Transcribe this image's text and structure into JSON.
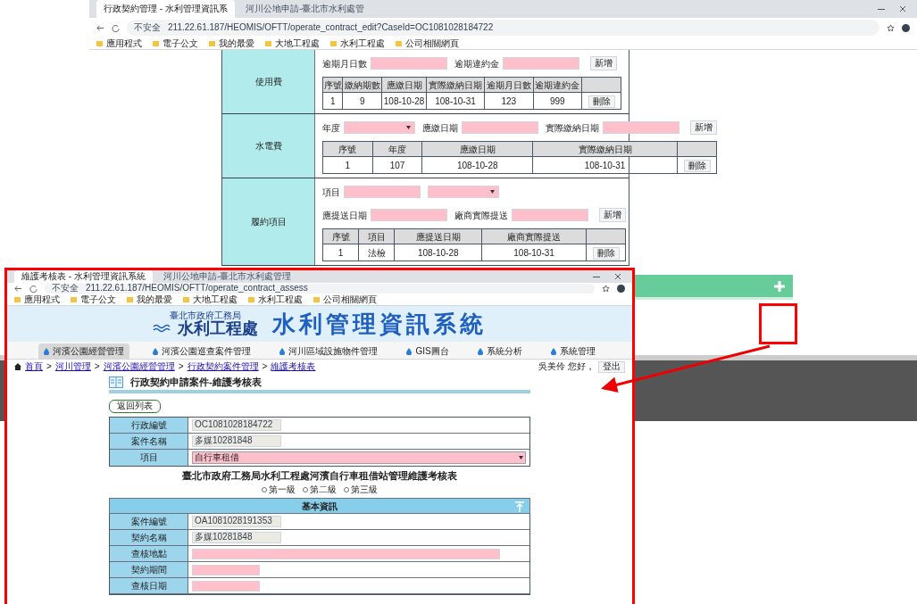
{
  "browser": {
    "tabs": [
      {
        "title": "行政契約管理 - 水利管理資訊系",
        "selected": true
      },
      {
        "title": "河川公地申請-臺北市水利處管",
        "selected": false
      }
    ],
    "security": "不安全",
    "url": "211.22.61.187/HEOMIS/OFTT/operate_contract_edit?CaseId=OC1081028184722",
    "bookmarks": [
      "應用程式",
      "電子公文",
      "我的最愛",
      "大地工程處",
      "水利工程處",
      "公司相關網頁"
    ]
  },
  "sections": [
    {
      "label": "使用費",
      "lines": [
        [
          {
            "kind": "input",
            "label": "逾期月日數"
          },
          {
            "kind": "input",
            "label": "逾期違約金"
          }
        ]
      ],
      "button": "新增",
      "columns": [
        "序號",
        "繳納期數",
        "應繳日期",
        "實際繳納日期",
        "逾期月日數",
        "逾期違約金"
      ],
      "rows": [
        {
          "cells": [
            "1",
            "9",
            "108-10-28",
            "108-10-31",
            "123",
            "999"
          ],
          "action": "刪除"
        }
      ]
    },
    {
      "label": "水電費",
      "lines": [
        [
          {
            "kind": "select",
            "label": "年度"
          },
          {
            "kind": "input",
            "label": "應繳日期"
          },
          {
            "kind": "input",
            "label": "實際繳納日期"
          }
        ]
      ],
      "button": "新增",
      "columns": [
        "序號",
        "年度",
        "應繳日期",
        "實際繳納日期"
      ],
      "rows": [
        {
          "cells": [
            "1",
            "107",
            "108-10-28",
            "108-10-31"
          ],
          "action": "刪除"
        }
      ]
    },
    {
      "label": "履約項目",
      "lines": [
        [
          {
            "kind": "input",
            "label": "項目"
          },
          {
            "kind": "select"
          }
        ],
        [
          {
            "kind": "input",
            "label": "應提送日期"
          },
          {
            "kind": "input",
            "label": "廠商實際提送"
          }
        ]
      ],
      "button": "新增",
      "columns": [
        "序號",
        "項目",
        "應提送日期",
        "廠商實際提送"
      ],
      "rows": [
        {
          "cells": [
            "1",
            "法檢",
            "108-10-28",
            "108-10-31"
          ],
          "action": "刪除"
        }
      ]
    }
  ],
  "inset": {
    "browser": {
      "tabs": [
        {
          "title": "維護考核表 - 水利管理資訊系統",
          "selected": true
        },
        {
          "title": "河川公地申請-臺北市水利處管理",
          "selected": false
        }
      ],
      "security": "不安全",
      "url": "211.22.61.187/HEOMIS/OFTT/operate_contract_assess",
      "bookmarks": [
        "應用程式",
        "電子公文",
        "我的最愛",
        "大地工程處",
        "水利工程處",
        "公司相關網頁"
      ]
    },
    "agency": "臺北市政府工務局",
    "office": "水利工程處",
    "system": "水利管理資訊系統",
    "nav": [
      {
        "label": "河濱公園經營管理",
        "selected": true
      },
      {
        "label": "河濱公園巡查案件管理",
        "selected": false
      },
      {
        "label": "河川區域設施物件管理",
        "selected": false
      },
      {
        "label": "GIS圖台",
        "selected": false
      },
      {
        "label": "系統分析",
        "selected": false
      },
      {
        "label": "系統管理",
        "selected": false
      }
    ],
    "breadcrumb": [
      {
        "label": "首頁"
      },
      {
        "separator": ">",
        "label": "河川管理"
      },
      {
        "separator": ">",
        "label": "河濱公園經營管理"
      },
      {
        "separator": ">",
        "label": "行政契約案件管理"
      },
      {
        "separator": ">",
        "label": "維護考核表"
      }
    ],
    "greeting": "吳美伶 您好，",
    "logout": "登出",
    "title": "行政契約申請案件-維護考核表",
    "back": "返回列表",
    "form": [
      {
        "label": "行政編號",
        "kind": "readonly",
        "value": "OC1081028184722"
      },
      {
        "label": "案件名稱",
        "kind": "readonly",
        "value": "多媒10281848"
      },
      {
        "label": "項目",
        "kind": "select",
        "value": "自行車租借"
      }
    ],
    "heading": "臺北市政府工務局水利工程處河濱自行車租借站管理維護考核表",
    "levels": [
      {
        "label": "第一級",
        "selected": false
      },
      {
        "label": "第二級",
        "selected": false
      },
      {
        "label": "第三級",
        "selected": false
      }
    ],
    "section_title": "基本資訊",
    "basic": [
      {
        "label": "案件編號",
        "kind": "readonly",
        "value": "OA1081028191353"
      },
      {
        "label": "契約名稱",
        "kind": "readonly",
        "value": "多媒10281848"
      },
      {
        "label": "查核地點",
        "kind": "long"
      },
      {
        "label": "契約期間",
        "kind": "short"
      },
      {
        "label": "查核日期",
        "kind": "short"
      }
    ]
  }
}
